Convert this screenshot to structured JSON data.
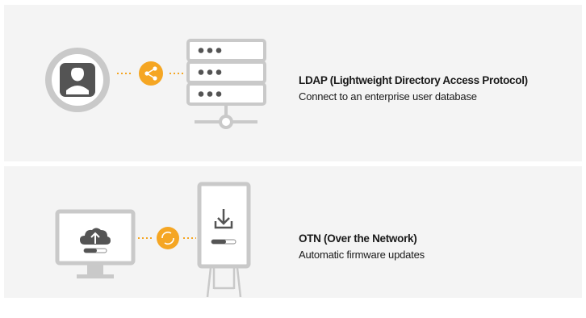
{
  "features": [
    {
      "id": "ldap",
      "title": "LDAP (Lightweight Directory Access Protocol)",
      "description": "Connect to an enterprise user database",
      "icons": [
        "user-avatar-icon",
        "share-icon",
        "server-icon"
      ]
    },
    {
      "id": "otn",
      "title": "OTN (Over the Network)",
      "description": "Automatic firmware updates",
      "icons": [
        "monitor-cloud-upload-icon",
        "sync-icon",
        "flip-stand-download-icon"
      ]
    }
  ],
  "colors": {
    "panel_bg": "#f4f4f4",
    "icon_gray": "#c9c9c9",
    "accent_orange": "#f5a623",
    "text": "#1a1a1a"
  }
}
